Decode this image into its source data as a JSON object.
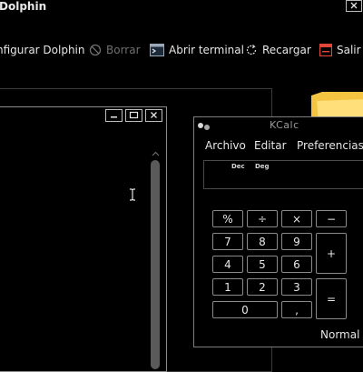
{
  "window": {
    "title": "Dolphin",
    "close_icon": "close-icon"
  },
  "toolbar": {
    "items": [
      {
        "label": "nfigurar Dolphin",
        "icon": "settings-icon",
        "enabled": true
      },
      {
        "label": "Borrar",
        "icon": "prohibited-icon",
        "enabled": false
      },
      {
        "label": "Abrir terminal",
        "icon": "terminal-icon",
        "enabled": true
      },
      {
        "label": "Recargar",
        "icon": "reload-icon",
        "enabled": true
      },
      {
        "label": "Salir",
        "icon": "quit-icon",
        "enabled": true
      }
    ]
  },
  "kcalc": {
    "title": "KCalc",
    "menu": [
      "Archivo",
      "Editar",
      "Preferencias"
    ],
    "display_tags": [
      "Dec",
      "Deg"
    ],
    "keys": [
      "%",
      "÷",
      "×",
      "−",
      "7",
      "8",
      "9",
      "+",
      "4",
      "5",
      "6",
      "1",
      "2",
      "3",
      "=",
      "0",
      ","
    ],
    "mode": "Normal"
  },
  "colors": {
    "background": "#000000",
    "text": "#e6e6e6",
    "disabled_text": "#6f6f6f",
    "border": "#8a8a8a",
    "folder": "#f5c542",
    "quit_icon": "#e0473a"
  }
}
